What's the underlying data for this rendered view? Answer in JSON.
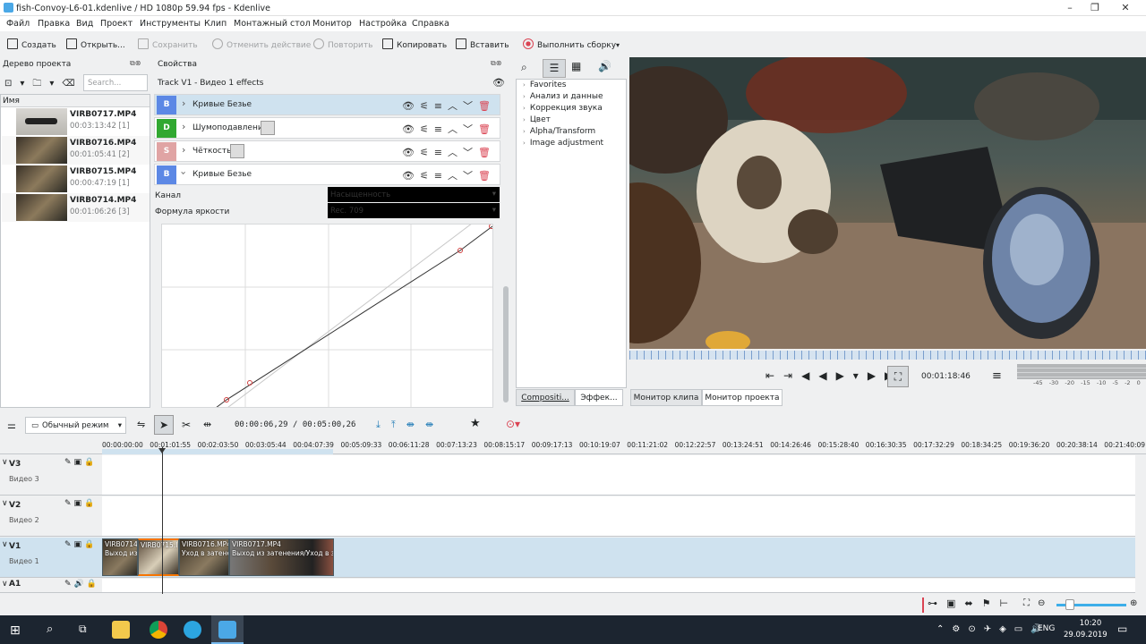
{
  "window": {
    "title": "fish-Convoy-L6-01.kdenlive / HD 1080p 59.94 fps - Kdenlive"
  },
  "menu": [
    "Файл",
    "Правка",
    "Вид",
    "Проект",
    "Инструменты",
    "Клип",
    "Монтажный стол",
    "Монитор",
    "Настройка",
    "Справка"
  ],
  "toolbar": {
    "create": "Создать",
    "open": "Открыть...",
    "save": "Сохранить",
    "undo": "Отменить действие",
    "redo": "Повторить",
    "copy": "Копировать",
    "paste": "Вставить",
    "render": "Выполнить сборку"
  },
  "project_bin": {
    "title": "Дерево проекта",
    "search_placeholder": "Search...",
    "column": "Имя",
    "clips": [
      {
        "name": "VIRB0717.MP4",
        "duration": "00:03:13:42 [1]"
      },
      {
        "name": "VIRB0716.MP4",
        "duration": "00:01:05:41 [2]"
      },
      {
        "name": "VIRB0715.MP4",
        "duration": "00:00:47:19 [1]"
      },
      {
        "name": "VIRB0714.MP4",
        "duration": "00:01:06:26 [3]"
      }
    ]
  },
  "properties": {
    "title": "Свойства",
    "track": "Track V1 - Видео 1 effects",
    "effects": [
      {
        "badge": "B",
        "label": "Кривые Безье",
        "color": "#5c88e5"
      },
      {
        "badge": "D",
        "label": "Шумоподавление",
        "color": "#31a831"
      },
      {
        "badge": "S",
        "label": "Чёткость",
        "color": "#e0a4a4"
      },
      {
        "badge": "B",
        "label": "Кривые Безье",
        "color": "#5c88e5"
      }
    ],
    "channel_label": "Канал",
    "channel_value": "Насыщенность",
    "luma_label": "Формула яркости",
    "luma_value": "Rec. 709"
  },
  "effects_tree": {
    "items": [
      "Favorites",
      "Анализ и данные",
      "Коррекция звука",
      "Цвет",
      "Alpha/Transform",
      "Image adjustment"
    ],
    "tab_compositions": "Compositi...",
    "tab_effects": "Эффек..."
  },
  "monitor": {
    "timecode": "00:01:18:46",
    "tab_clip": "Монитор клипа",
    "tab_project": "Монитор проекта",
    "meter_scale": [
      "-45",
      "-30",
      "-20",
      "-15",
      "-10",
      "-5",
      "-2",
      "0"
    ]
  },
  "timeline": {
    "mode": "Обычный режим",
    "position": "00:00:06,29 / 00:05:00,26",
    "ruler": [
      "00:00:00:00",
      "00:01:01:55",
      "00:02:03:50",
      "00:03:05:44",
      "00:04:07:39",
      "00:05:09:33",
      "00:06:11:28",
      "00:07:13:23",
      "00:08:15:17",
      "00:09:17:13",
      "00:10:19:07",
      "00:11:21:02",
      "00:12:22:57",
      "00:13:24:51",
      "00:14:26:46",
      "00:15:28:40",
      "00:16:30:35",
      "00:17:32:29",
      "00:18:34:25",
      "00:19:36:20",
      "00:20:38:14",
      "00:21:40:09"
    ],
    "tracks": [
      {
        "name": "V3",
        "sub": "Видео 3"
      },
      {
        "name": "V2",
        "sub": "Видео 2"
      },
      {
        "name": "V1",
        "sub": "Видео 1"
      },
      {
        "name": "A1",
        "sub": ""
      }
    ],
    "clips": [
      {
        "name": "VIRB0714.",
        "sub": "Выход из"
      },
      {
        "name": "VIRB0715.I",
        "sub": ""
      },
      {
        "name": "VIRB0716.MP4",
        "sub": "Уход в затенен"
      },
      {
        "name": "VIRB0717.MP4",
        "sub": "Выход из затенения/Уход в з"
      }
    ]
  },
  "taskbar": {
    "lang": "ENG",
    "time": "10:20",
    "date": "29.09.2019"
  }
}
